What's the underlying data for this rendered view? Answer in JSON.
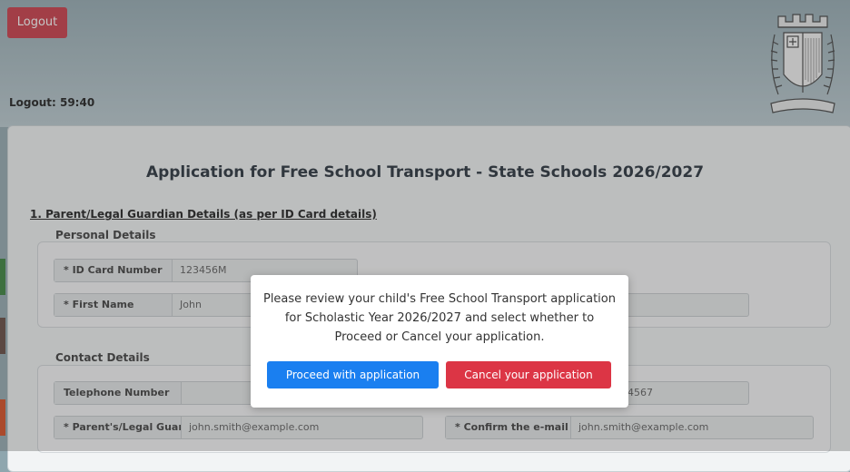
{
  "header": {
    "logout_label": "Logout",
    "timer_text": "Logout: 59:40"
  },
  "form": {
    "title": "Application for Free School Transport - State Schools 2026/2027",
    "section_title": "1. Parent/Legal Guardian Details (as per ID Card details)",
    "personal": {
      "heading": "Personal Details",
      "id_card_label": "* ID Card Number",
      "id_card_value": "123456M",
      "first_name_label": "* First Name",
      "first_name_value": "John"
    },
    "contact": {
      "heading": "Contact Details",
      "telephone_label": "Telephone Number",
      "telephone_value": "",
      "mobile_partial_value": "4567",
      "email_label": "* Parent's/Legal Guar...",
      "email_value": "john.smith@example.com",
      "confirm_email_label": "* Confirm the e-mail ...",
      "confirm_email_value": "john.smith@example.com"
    }
  },
  "modal": {
    "message": "Please review your child's Free School Transport application for Scholastic Year 2026/2027 and select whether to Proceed or Cancel your application.",
    "proceed_label": "Proceed with application",
    "cancel_label": "Cancel your application"
  },
  "colors": {
    "header_bg": "#91a8b0",
    "logout_red": "#c9303e",
    "proceed_blue": "#1a7ff0",
    "cancel_red": "#dc3545"
  },
  "icons": {
    "crest": "malta-coat-of-arms-icon"
  }
}
